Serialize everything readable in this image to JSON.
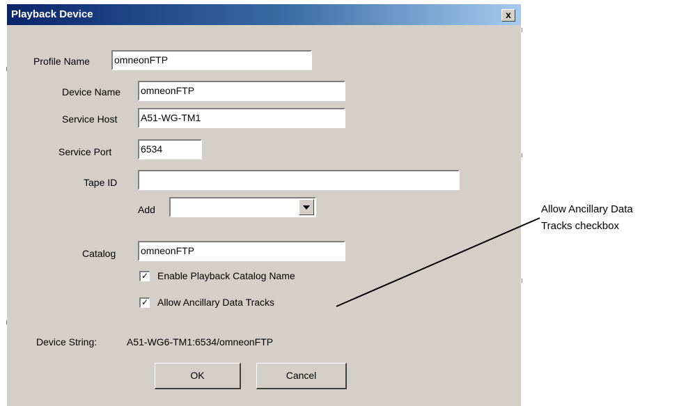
{
  "dialog": {
    "title": "Playback Device",
    "close_label": "x"
  },
  "form": {
    "profile_name_label": "Profile Name",
    "profile_name_value": "omneonFTP",
    "device_name_label": "Device Name",
    "device_name_value": "omneonFTP",
    "service_host_label": "Service Host",
    "service_host_value": "A51-WG-TM1",
    "service_port_label": "Service Port",
    "service_port_value": "6534",
    "tape_id_label": "Tape ID",
    "tape_id_value": "",
    "add_label": "Add",
    "add_value": "",
    "catalog_label": "Catalog",
    "catalog_value": "omneonFTP",
    "enable_catalog_label": "Enable Playback Catalog Name",
    "enable_catalog_checked": true,
    "allow_ancillary_label": "Allow Ancillary Data Tracks",
    "allow_ancillary_checked": true,
    "device_string_label": "Device String:",
    "device_string_value": "A51-WG6-TM1:6534/omneonFTP"
  },
  "buttons": {
    "ok_label": "OK",
    "cancel_label": "Cancel"
  },
  "annotation": {
    "line1": "Allow Ancillary Data",
    "line2": "Tracks checkbox"
  }
}
